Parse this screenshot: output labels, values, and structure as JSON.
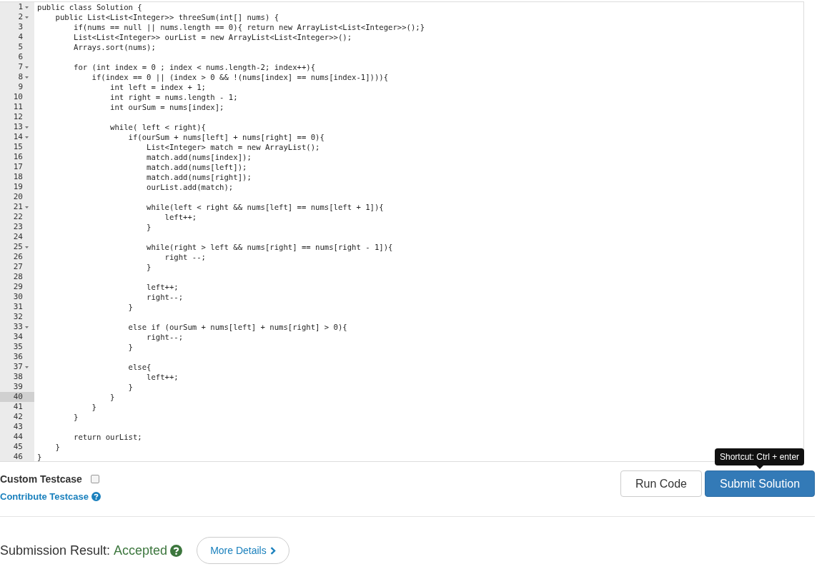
{
  "editor": {
    "lines": [
      {
        "number": "1",
        "code": "public class Solution {",
        "foldable": true,
        "active": false
      },
      {
        "number": "2",
        "code": "    public List<List<Integer>> threeSum(int[] nums) {",
        "foldable": true,
        "active": false
      },
      {
        "number": "3",
        "code": "        if(nums == null || nums.length == 0){ return new ArrayList<List<Integer>>();}",
        "foldable": false,
        "active": false
      },
      {
        "number": "4",
        "code": "        List<List<Integer>> ourList = new ArrayList<List<Integer>>();",
        "foldable": false,
        "active": false
      },
      {
        "number": "5",
        "code": "        Arrays.sort(nums);",
        "foldable": false,
        "active": false
      },
      {
        "number": "6",
        "foldable": false,
        "active": false
      },
      {
        "number": "7",
        "code": "        for (int index = 0 ; index < nums.length-2; index++){",
        "foldable": true,
        "active": false
      },
      {
        "number": "8",
        "code": "            if(index == 0 || (index > 0 && !(nums[index] == nums[index-1]))){",
        "foldable": true,
        "active": false
      },
      {
        "number": "9",
        "code": "                int left = index + 1;",
        "foldable": false,
        "active": false
      },
      {
        "number": "10",
        "code": "                int right = nums.length - 1;",
        "foldable": false,
        "active": false
      },
      {
        "number": "11",
        "code": "                int ourSum = nums[index];",
        "foldable": false,
        "active": false
      },
      {
        "number": "12",
        "foldable": false,
        "active": false
      },
      {
        "number": "13",
        "code": "                while( left < right){",
        "foldable": true,
        "active": false
      },
      {
        "number": "14",
        "code": "                    if(ourSum + nums[left] + nums[right] == 0){",
        "foldable": true,
        "active": false
      },
      {
        "number": "15",
        "code": "                        List<Integer> match = new ArrayList();",
        "foldable": false,
        "active": false
      },
      {
        "number": "16",
        "code": "                        match.add(nums[index]);",
        "foldable": false,
        "active": false
      },
      {
        "number": "17",
        "code": "                        match.add(nums[left]);",
        "foldable": false,
        "active": false
      },
      {
        "number": "18",
        "code": "                        match.add(nums[right]);",
        "foldable": false,
        "active": false
      },
      {
        "number": "19",
        "code": "                        ourList.add(match);",
        "foldable": false,
        "active": false
      },
      {
        "number": "20",
        "foldable": false,
        "active": false
      },
      {
        "number": "21",
        "code": "                        while(left < right && nums[left] == nums[left + 1]){",
        "foldable": true,
        "active": false
      },
      {
        "number": "22",
        "code": "                            left++;",
        "foldable": false,
        "active": false
      },
      {
        "number": "23",
        "code": "                        }",
        "foldable": false,
        "active": false
      },
      {
        "number": "24",
        "foldable": false,
        "active": false
      },
      {
        "number": "25",
        "code": "                        while(right > left && nums[right] == nums[right - 1]){",
        "foldable": true,
        "active": false
      },
      {
        "number": "26",
        "code": "                            right --;",
        "foldable": false,
        "active": false
      },
      {
        "number": "27",
        "code": "                        }",
        "foldable": false,
        "active": false
      },
      {
        "number": "28",
        "foldable": false,
        "active": false
      },
      {
        "number": "29",
        "code": "                        left++;",
        "foldable": false,
        "active": false
      },
      {
        "number": "30",
        "code": "                        right--;",
        "foldable": false,
        "active": false
      },
      {
        "number": "31",
        "code": "                    }",
        "foldable": false,
        "active": false
      },
      {
        "number": "32",
        "foldable": false,
        "active": false
      },
      {
        "number": "33",
        "code": "                    else if (ourSum + nums[left] + nums[right] > 0){",
        "foldable": true,
        "active": false
      },
      {
        "number": "34",
        "code": "                        right--;",
        "foldable": false,
        "active": false
      },
      {
        "number": "35",
        "code": "                    }",
        "foldable": false,
        "active": false
      },
      {
        "number": "36",
        "foldable": false,
        "active": false
      },
      {
        "number": "37",
        "code": "                    else{",
        "foldable": true,
        "active": false
      },
      {
        "number": "38",
        "code": "                        left++;",
        "foldable": false,
        "active": false
      },
      {
        "number": "39",
        "code": "                    }",
        "foldable": false,
        "active": false
      },
      {
        "number": "40",
        "code": "                }",
        "foldable": false,
        "active": true
      },
      {
        "number": "41",
        "code": "            }",
        "foldable": false,
        "active": false
      },
      {
        "number": "42",
        "code": "        }",
        "foldable": false,
        "active": false
      },
      {
        "number": "43",
        "foldable": false,
        "active": false
      },
      {
        "number": "44",
        "code": "        return ourList;",
        "foldable": false,
        "active": false
      },
      {
        "number": "45",
        "code": "    }",
        "foldable": false,
        "active": false
      },
      {
        "number": "46",
        "code": "}",
        "foldable": false,
        "active": false
      }
    ]
  },
  "custom_testcase": {
    "label": "Custom Testcase",
    "checked": false
  },
  "contribute_link": "Contribute Testcase",
  "tooltip": "Shortcut: Ctrl + enter",
  "buttons": {
    "run": "Run Code",
    "submit": "Submit Solution"
  },
  "result": {
    "label": "Submission Result:",
    "status": "Accepted",
    "details_button": "More Details"
  }
}
